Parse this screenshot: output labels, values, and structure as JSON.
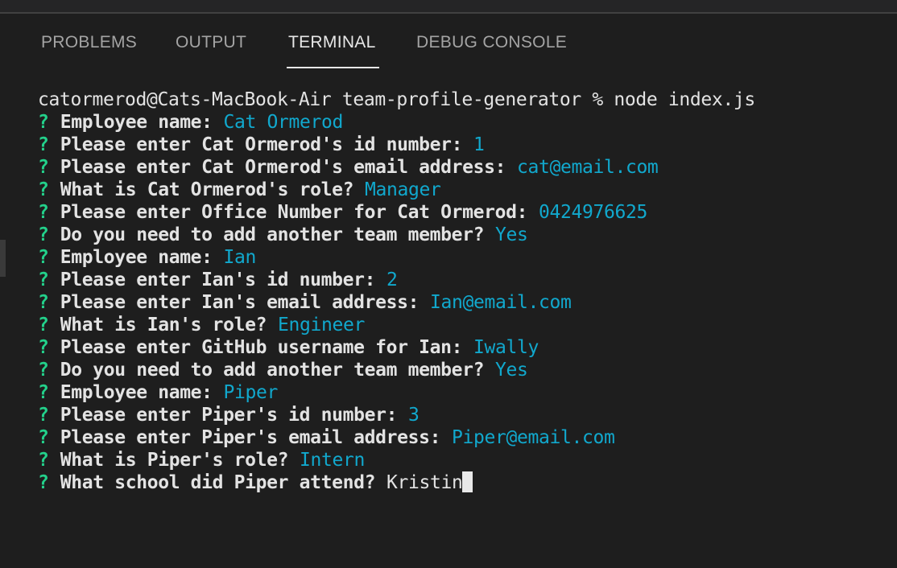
{
  "panel": {
    "tabs": [
      {
        "label": "PROBLEMS",
        "active": false
      },
      {
        "label": "OUTPUT",
        "active": false
      },
      {
        "label": "TERMINAL",
        "active": true
      },
      {
        "label": "DEBUG CONSOLE",
        "active": false
      }
    ]
  },
  "terminal": {
    "command_line": "catormerod@Cats-MacBook-Air team-profile-generator % node index.js",
    "question_mark": "?",
    "lines": [
      {
        "prompt": "Employee name:",
        "answer": "Cat Ormerod"
      },
      {
        "prompt": "Please enter Cat Ormerod's id number:",
        "answer": "1"
      },
      {
        "prompt": "Please enter Cat Ormerod's email address:",
        "answer": "cat@email.com"
      },
      {
        "prompt": "What is Cat Ormerod's role?",
        "answer": "Manager"
      },
      {
        "prompt": "Please enter Office Number for Cat Ormerod:",
        "answer": "0424976625"
      },
      {
        "prompt": "Do you need to add another team member?",
        "answer": "Yes"
      },
      {
        "prompt": "Employee name:",
        "answer": "Ian"
      },
      {
        "prompt": "Please enter Ian's id number:",
        "answer": "2"
      },
      {
        "prompt": "Please enter Ian's email address:",
        "answer": "Ian@email.com"
      },
      {
        "prompt": "What is Ian's role?",
        "answer": "Engineer"
      },
      {
        "prompt": "Please enter GitHub username for Ian:",
        "answer": "Iwally"
      },
      {
        "prompt": "Do you need to add another team member?",
        "answer": "Yes"
      },
      {
        "prompt": "Employee name:",
        "answer": "Piper"
      },
      {
        "prompt": "Please enter Piper's id number:",
        "answer": "3"
      },
      {
        "prompt": "Please enter Piper's email address:",
        "answer": "Piper@email.com"
      },
      {
        "prompt": "What is Piper's role?",
        "answer": "Intern"
      },
      {
        "prompt": "What school did Piper attend?",
        "answer": "Kristin",
        "typing": true
      }
    ]
  },
  "colors": {
    "background": "#1e1e1e",
    "question_mark": "#23d18b",
    "answer": "#11a8cd",
    "text": "#e3e3e3"
  }
}
